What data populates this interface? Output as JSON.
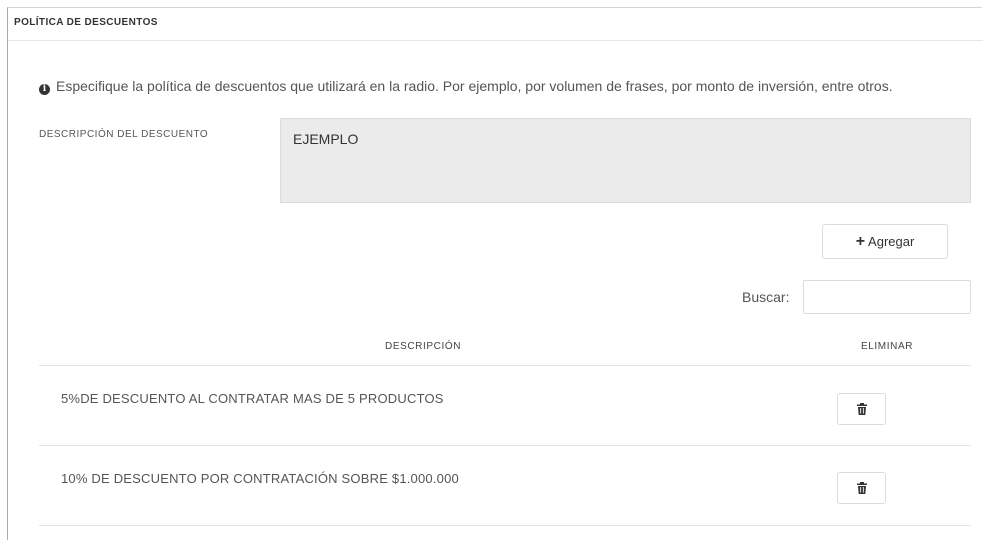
{
  "panel": {
    "title": "POLÍTICA DE DESCUENTOS"
  },
  "info": {
    "icon": "info-circle-icon",
    "text": "Especifique la política de descuentos que utilizará en la radio. Por ejemplo, por volumen de frases, por monto de inversión, entre otros."
  },
  "description_field": {
    "label": "DESCRIPCIÓN DEL DESCUENTO",
    "value": "EJEMPLO"
  },
  "add_button": {
    "icon": "plus-icon",
    "label": "Agregar"
  },
  "search": {
    "label": "Buscar:",
    "value": ""
  },
  "table": {
    "columns": [
      "DESCRIPCIÓN",
      "ELIMINAR"
    ],
    "rows": [
      {
        "description": "5%DE DESCUENTO AL CONTRATAR MAS DE 5 PRODUCTOS",
        "delete_icon": "trash-icon"
      },
      {
        "description": "10% DE DESCUENTO POR CONTRATACIÓN SOBRE $1.000.000",
        "delete_icon": "trash-icon"
      }
    ]
  },
  "colors": {
    "description_box_bg": "#ebebeb",
    "border": "#dcdcdc",
    "text": "#555555"
  }
}
